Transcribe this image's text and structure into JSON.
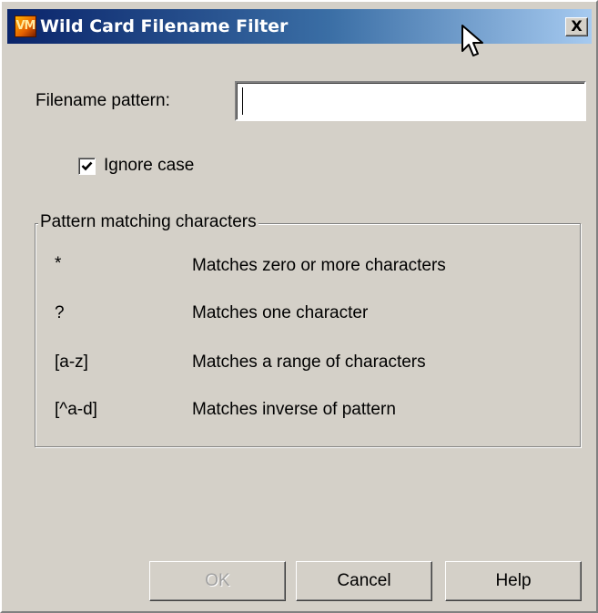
{
  "window": {
    "title": "Wild Card Filename Filter",
    "icon_text": "VM",
    "close_label": "X"
  },
  "form": {
    "pattern_label": "Filename pattern:",
    "pattern_value": "",
    "ignore_case_label": "Ignore case",
    "ignore_case_checked": true
  },
  "group": {
    "title": "Pattern matching characters",
    "rows": [
      {
        "key": "*",
        "description": "Matches zero or more characters"
      },
      {
        "key": "?",
        "description": "Matches one character"
      },
      {
        "key": "[a-z]",
        "description": "Matches a range of characters"
      },
      {
        "key": "[^a-d]",
        "description": "Matches inverse of pattern"
      }
    ]
  },
  "buttons": {
    "ok": "OK",
    "cancel": "Cancel",
    "help": "Help"
  },
  "colors": {
    "titlebar_start": "#0a246a",
    "titlebar_end": "#a6caf0",
    "dialog_bg": "#d4d0c8"
  }
}
